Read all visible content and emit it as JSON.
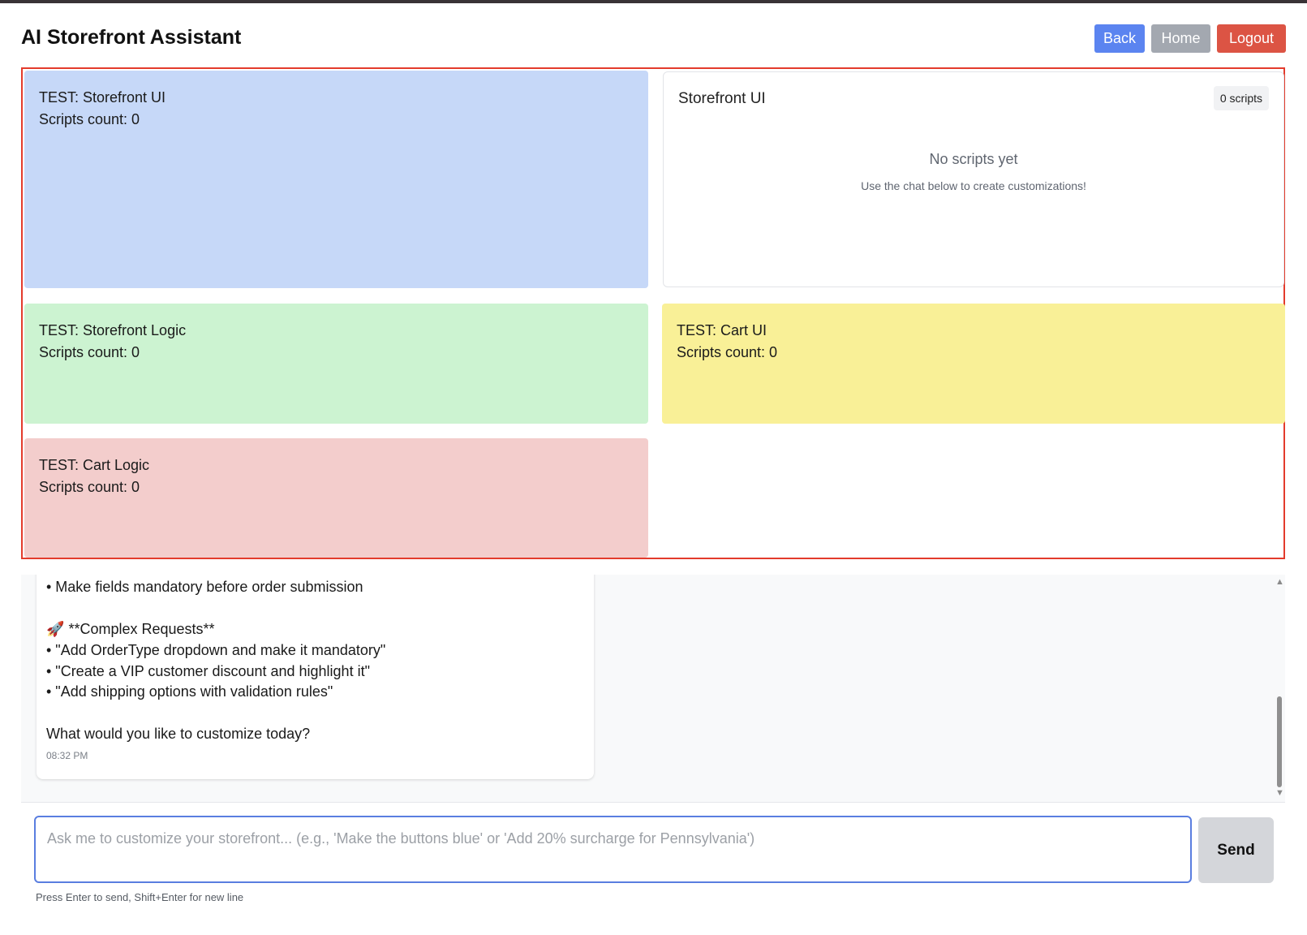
{
  "header": {
    "title": "AI Storefront Assistant",
    "buttons": {
      "back": "Back",
      "home": "Home",
      "logout": "Logout"
    }
  },
  "colors": {
    "back_button": "#5b84f0",
    "home_button": "#a3a8b0",
    "logout_button": "#dc5444",
    "grid_border": "#e33b2c",
    "storefront_ui": "#c6d8f8",
    "storefront_logic": "#ccf3d1",
    "cart_ui": "#f9f097",
    "cart_logic": "#f3cdcc",
    "input_border": "#5a7ee0"
  },
  "panels": {
    "storefront_ui_test": {
      "title": "TEST: Storefront UI",
      "count": "Scripts count: 0"
    },
    "storefront_logic_test": {
      "title": "TEST: Storefront Logic",
      "count": "Scripts count: 0"
    },
    "cart_ui_test": {
      "title": "TEST: Cart UI",
      "count": "Scripts count: 0"
    },
    "cart_logic_test": {
      "title": "TEST: Cart Logic",
      "count": "Scripts count: 0"
    }
  },
  "scripts_panel": {
    "title": "Storefront UI",
    "badge": "0 scripts",
    "empty_title": "No scripts yet",
    "empty_hint": "Use the chat below to create customizations!"
  },
  "chat": {
    "message": {
      "lines": [
        "• Make fields mandatory before order submission",
        "**Complex Requests**",
        "• \"Add OrderType dropdown and make it mandatory\"",
        "• \"Create a VIP customer discount and highlight it\"",
        "• \"Add shipping options with validation rules\"",
        "What would you like to customize today?"
      ],
      "icon": "rocket-icon",
      "time": "08:32 PM"
    }
  },
  "input": {
    "placeholder": "Ask me to customize your storefront... (e.g., 'Make the buttons blue' or 'Add 20% surcharge for Pennsylvania')",
    "value": "",
    "send_label": "Send",
    "hint": "Press Enter to send, Shift+Enter for new line"
  }
}
